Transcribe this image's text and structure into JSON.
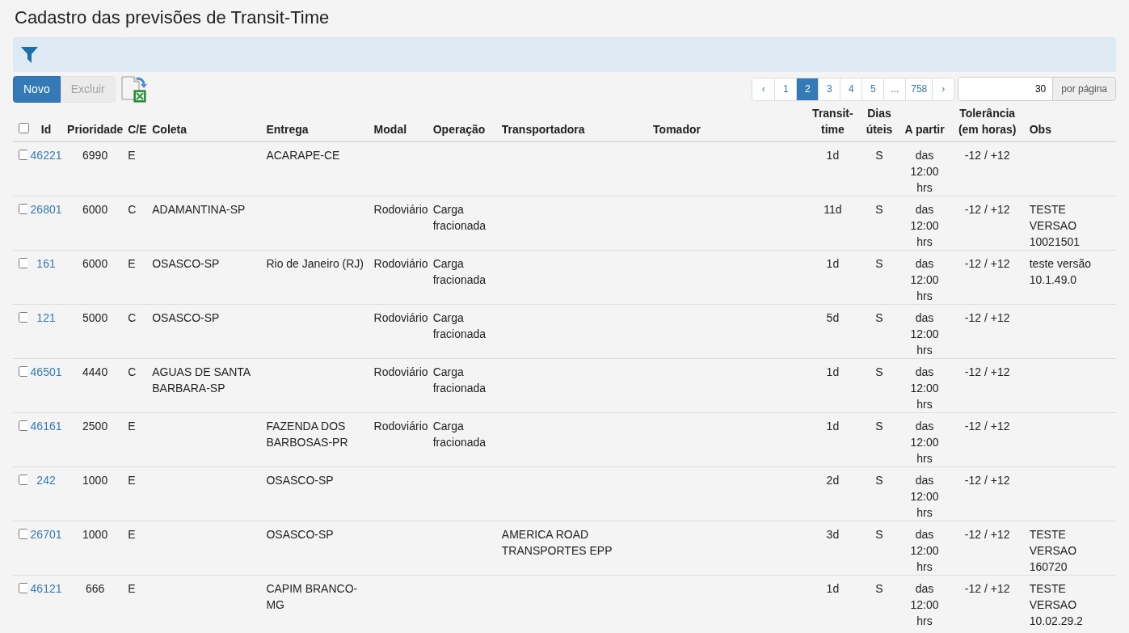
{
  "title": "Cadastro das previsões de Transit-Time",
  "toolbar": {
    "buttons": [
      {
        "label": "Novo",
        "kind": "primary",
        "disabled": false
      },
      {
        "label": "Excluir",
        "kind": "default",
        "disabled": true
      }
    ]
  },
  "pagination": {
    "pages": [
      {
        "label": "‹",
        "selected": false
      },
      {
        "label": "1",
        "selected": false
      },
      {
        "label": "2",
        "selected": true
      },
      {
        "label": "3",
        "selected": false
      },
      {
        "label": "4",
        "selected": false
      },
      {
        "label": "5",
        "selected": false
      },
      {
        "label": "...",
        "selected": false
      },
      {
        "label": "758",
        "selected": false
      },
      {
        "label": "›",
        "selected": false
      }
    ],
    "per_page": {
      "value": "30",
      "label": "por página"
    }
  },
  "table": {
    "select_all": {
      "checked": false
    },
    "columns": [
      "Id",
      "Prioridade",
      "C/E",
      "Coleta",
      "Entrega",
      "Modal",
      "Operação",
      "Transportadora",
      "Tomador",
      "Transit-time",
      "Dias úteis",
      "A partir",
      "Tolerância (em horas)",
      "Obs"
    ],
    "rows": [
      {
        "selected": false,
        "cells": [
          "46221",
          "6990",
          "E",
          "",
          "ACARAPE-CE",
          "",
          "",
          "",
          "",
          "1d",
          "S",
          "das 12:00 hrs",
          "-12 / +12",
          ""
        ]
      },
      {
        "selected": false,
        "cells": [
          "26801",
          "6000",
          "C",
          "ADAMANTINA-SP",
          "",
          "Rodoviário",
          "Carga fracionada",
          "",
          "",
          "11d",
          "S",
          "das 12:00 hrs",
          "-12 / +12",
          "TESTE VERSAO 10021501"
        ]
      },
      {
        "selected": false,
        "cells": [
          "161",
          "6000",
          "E",
          "OSASCO-SP",
          "Rio de Janeiro (RJ)",
          "Rodoviário",
          "Carga fracionada",
          "",
          "",
          "1d",
          "S",
          "das 12:00 hrs",
          "-12 / +12",
          "teste versão 10.1.49.0"
        ]
      },
      {
        "selected": false,
        "cells": [
          "121",
          "5000",
          "C",
          "OSASCO-SP",
          "",
          "Rodoviário",
          "Carga fracionada",
          "",
          "",
          "5d",
          "S",
          "das 12:00 hrs",
          "-12 / +12",
          ""
        ]
      },
      {
        "selected": false,
        "cells": [
          "46501",
          "4440",
          "C",
          "AGUAS DE SANTA BARBARA-SP",
          "",
          "Rodoviário",
          "Carga fracionada",
          "",
          "",
          "1d",
          "S",
          "das 12:00 hrs",
          "-12 / +12",
          ""
        ]
      },
      {
        "selected": false,
        "cells": [
          "46161",
          "2500",
          "E",
          "",
          "FAZENDA DOS BARBOSAS-PR",
          "Rodoviário",
          "Carga fracionada",
          "",
          "",
          "1d",
          "S",
          "das 12:00 hrs",
          "-12 / +12",
          ""
        ]
      },
      {
        "selected": false,
        "cells": [
          "242",
          "1000",
          "E",
          "",
          "OSASCO-SP",
          "",
          "",
          "",
          "",
          "2d",
          "S",
          "das 12:00 hrs",
          "-12 / +12",
          ""
        ]
      },
      {
        "selected": false,
        "cells": [
          "26701",
          "1000",
          "E",
          "",
          "OSASCO-SP",
          "",
          "",
          "AMERICA ROAD TRANSPORTES EPP",
          "",
          "3d",
          "S",
          "das 12:00 hrs",
          "-12 / +12",
          "TESTE VERSAO 160720"
        ]
      },
      {
        "selected": false,
        "cells": [
          "46121",
          "666",
          "E",
          "",
          "CAPIM BRANCO-MG",
          "",
          "",
          "",
          "",
          "1d",
          "S",
          "das 12:00 hrs",
          "-12 / +12",
          "TESTE VERSAO 10.02.29.2"
        ]
      }
    ]
  }
}
